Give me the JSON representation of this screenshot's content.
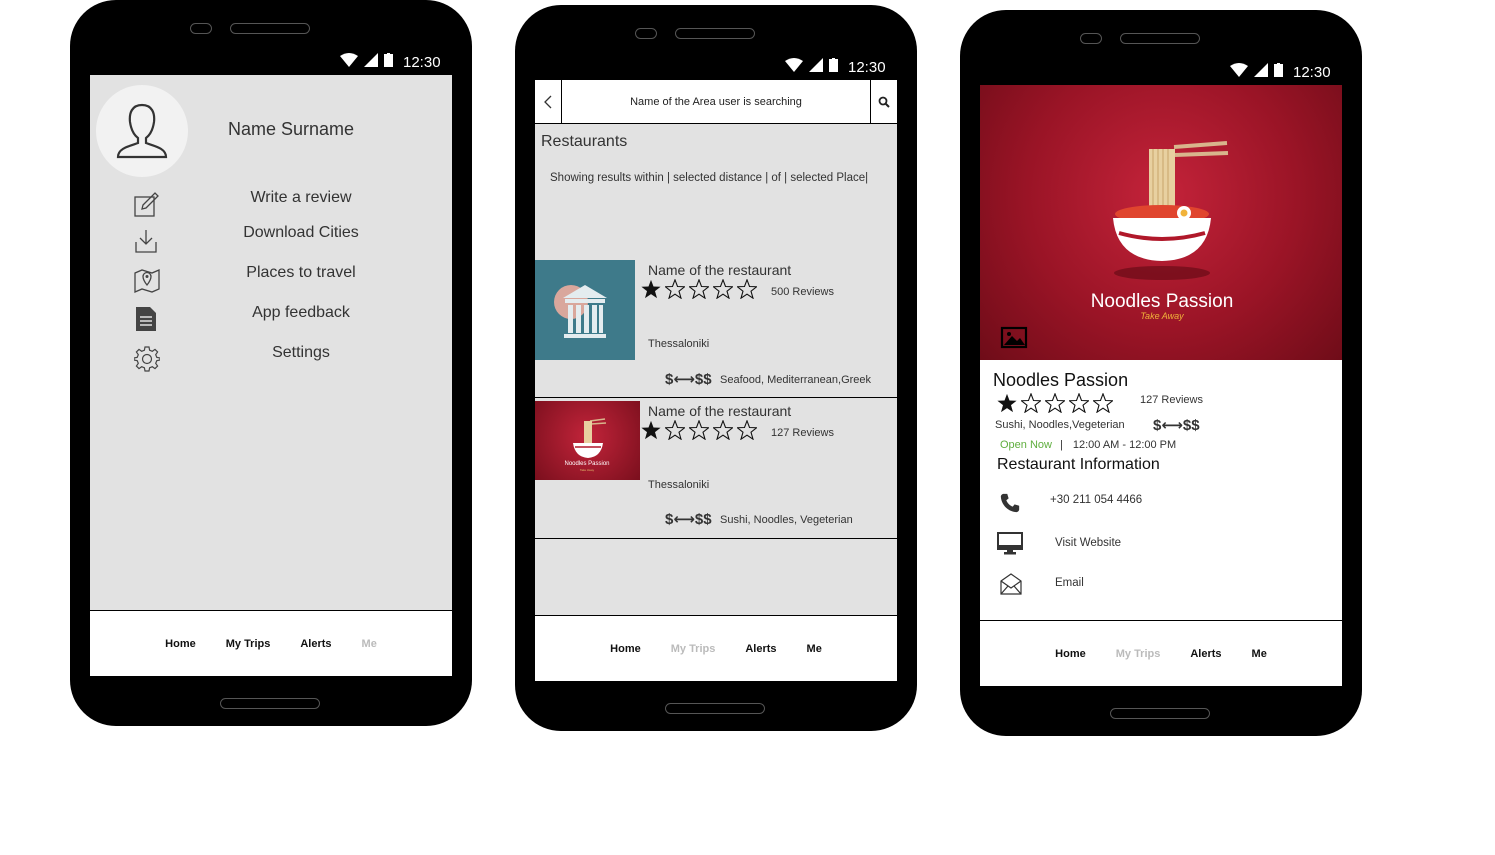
{
  "status_bar": {
    "time": "12:30"
  },
  "nav": {
    "home": "Home",
    "my_trips": "My Trips",
    "alerts": "Alerts",
    "me": "Me"
  },
  "profile": {
    "name": "Name Surname",
    "menu": [
      {
        "label": "Write a review",
        "icon": "edit-icon"
      },
      {
        "label": "Download Cities",
        "icon": "download-icon"
      },
      {
        "label": "Places to travel",
        "icon": "map-pin-icon"
      },
      {
        "label": "App feedback",
        "icon": "document-icon"
      },
      {
        "label": "Settings",
        "icon": "gear-icon"
      }
    ]
  },
  "search": {
    "query": "Name of the Area user is searching",
    "heading": "Restaurants",
    "results_note": "Showing results within | selected distance | of | selected Place|",
    "results": [
      {
        "name": "Name of the restaurant",
        "rating": 1,
        "reviews": "500 Reviews",
        "city": "Thessaloniki",
        "price": "$⟷$$",
        "cuisine": "Seafood, Mediterranean,Greek"
      },
      {
        "name": "Name of the restaurant",
        "rating": 1,
        "reviews": "127 Reviews",
        "city": "Thessaloniki",
        "price": "$⟷$$",
        "cuisine": "Sushi, Noodles, Vegeterian"
      }
    ]
  },
  "detail": {
    "logo_title": "Noodles Passion",
    "logo_subtitle": "Take Away",
    "name": "Noodles Passion",
    "rating": 1,
    "reviews": "127 Reviews",
    "cuisine": "Sushi, Noodles,Vegeterian",
    "price": "$⟷$$",
    "open_status": "Open Now",
    "separator": "|",
    "hours": "12:00 AM - 12:00 PM",
    "info_heading": "Restaurant Information",
    "phone": "+30 211 054 4466",
    "website": "Visit Website",
    "email": "Email"
  },
  "colors": {
    "screen_bg": "#e2e2e2",
    "logo_red": "#b0182a",
    "open_green": "#5fae3e",
    "museum_blue": "#3e7a8a"
  }
}
